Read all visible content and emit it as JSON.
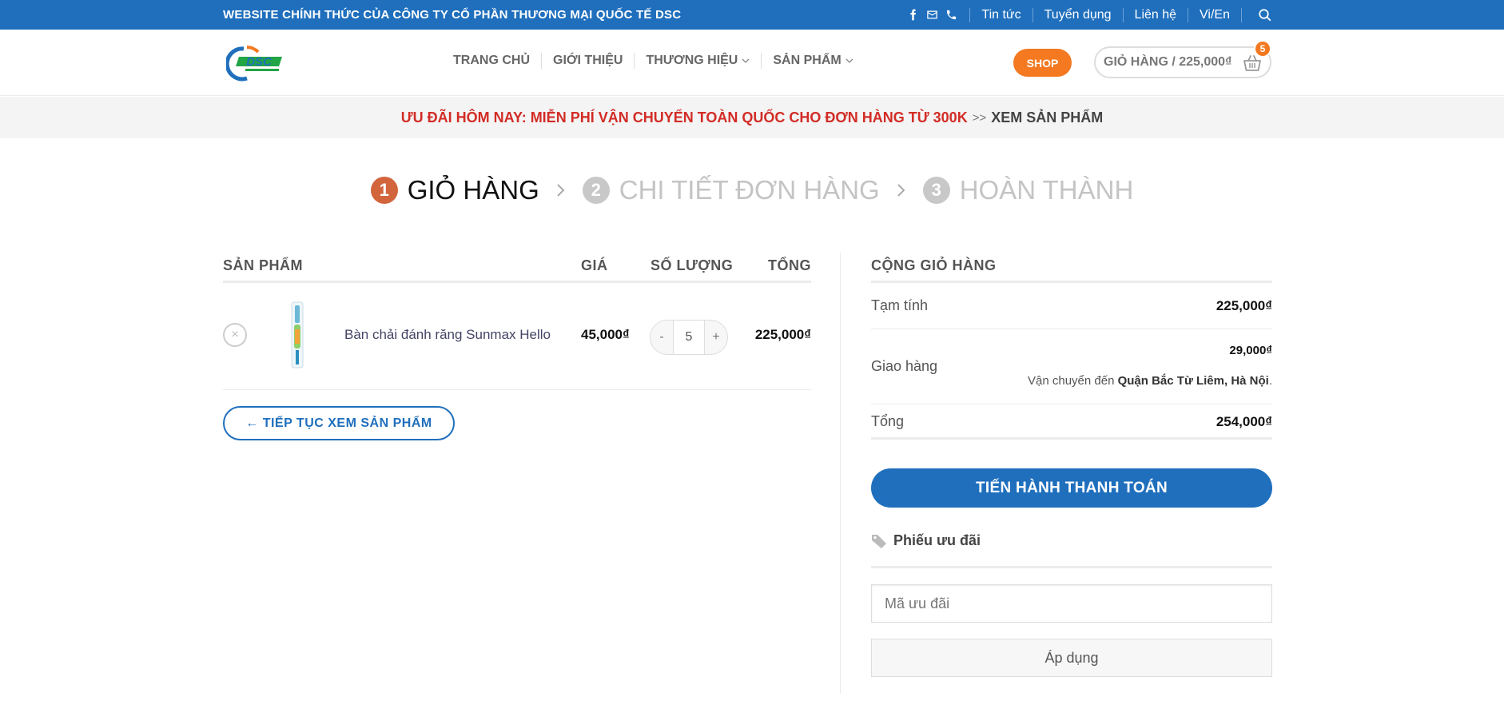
{
  "topbar": {
    "slogan": "WEBSITE CHÍNH THỨC CỦA CÔNG TY CỔ PHẦN THƯƠNG MẠI QUỐC TẾ DSC",
    "links": [
      "Tin tức",
      "Tuyển dụng",
      "Liên hệ",
      "Vi/En"
    ],
    "icons": [
      "facebook-icon",
      "email-icon",
      "phone-icon",
      "search-icon"
    ]
  },
  "header": {
    "logo_text": "DSC",
    "nav": [
      "TRANG CHỦ",
      "GIỚI THIỆU",
      "THƯƠNG HIỆU",
      "SẢN PHẨM"
    ],
    "shop_label": "SHOP",
    "cart_label": "GIỎ HÀNG / 225,000₫",
    "cart_count": "5"
  },
  "promo": {
    "highlight": "ƯU ĐÃI HÔM NAY: MIỄN PHÍ VẬN CHUYỂN TOÀN QUỐC CHO ĐƠN HÀNG TỪ 300K",
    "arrow": ">>",
    "link": "XEM SẢN PHẨM"
  },
  "steps": [
    {
      "num": "1",
      "label": "GIỎ HÀNG"
    },
    {
      "num": "2",
      "label": "CHI TIẾT ĐƠN HÀNG"
    },
    {
      "num": "3",
      "label": "HOÀN THÀNH"
    }
  ],
  "cart": {
    "headers": {
      "product": "SẢN PHẨM",
      "price": "GIÁ",
      "qty": "SỐ LƯỢNG",
      "total": "TỔNG"
    },
    "items": [
      {
        "name": "Bàn chải đánh răng Sunmax Hello",
        "price": "45,000₫",
        "qty": "5",
        "total": "225,000₫"
      }
    ],
    "qty_minus": "-",
    "qty_plus": "+",
    "remove": "×",
    "continue_label": "← TIẾP TỤC XEM SẢN PHẨM"
  },
  "totals": {
    "title": "CỘNG GIỎ HÀNG",
    "subtotal_label": "Tạm tính",
    "subtotal_value": "225,000₫",
    "shipping_label": "Giao hàng",
    "shipping_value": "29,000₫",
    "shipping_note_prefix": "Vận chuyển đến",
    "shipping_note_place": "Quận Bắc Từ Liêm, Hà Nội",
    "shipping_note_suffix": ".",
    "total_label": "Tổng",
    "total_value": "254,000₫",
    "checkout_label": "TIẾN HÀNH THANH TOÁN",
    "coupon_title": "Phiếu ưu đãi",
    "coupon_placeholder": "Mã ưu đãi",
    "apply_label": "Áp dụng"
  },
  "colors": {
    "primary": "#1f6fbd",
    "accent": "#f47920",
    "promo_red": "#d22c26",
    "step_active": "#d2653c"
  }
}
